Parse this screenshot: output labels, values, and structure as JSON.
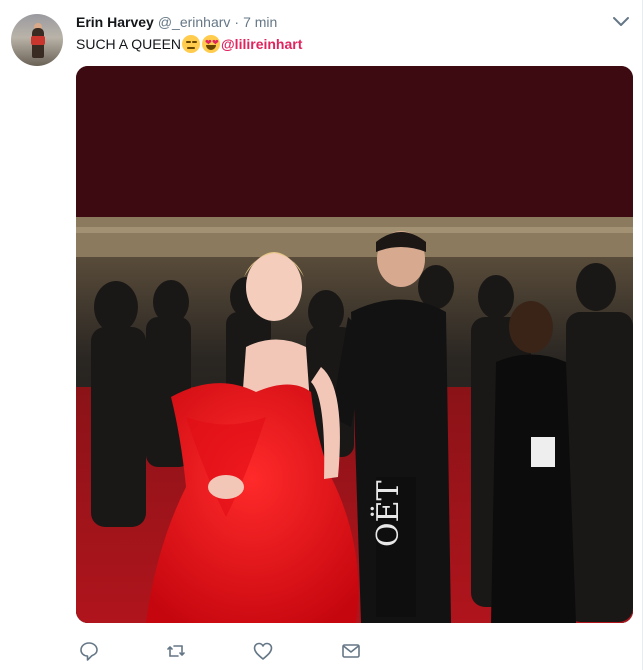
{
  "tweet": {
    "display_name": "Erin Harvey",
    "handle": "@_erinharv",
    "separator": "·",
    "time": "7 min",
    "text_prefix": "SUCH A QUEEN",
    "emoji": [
      "smirk-face-emoji",
      "heart-eyes-emoji"
    ],
    "mention": "@lilireinhart",
    "accent_color": "#e0245e",
    "photo_banner_text": "OËT"
  },
  "actions": [
    {
      "name": "reply",
      "icon": "reply-icon"
    },
    {
      "name": "retweet",
      "icon": "retweet-icon"
    },
    {
      "name": "like",
      "icon": "heart-icon"
    },
    {
      "name": "direct-message",
      "icon": "envelope-icon"
    }
  ]
}
